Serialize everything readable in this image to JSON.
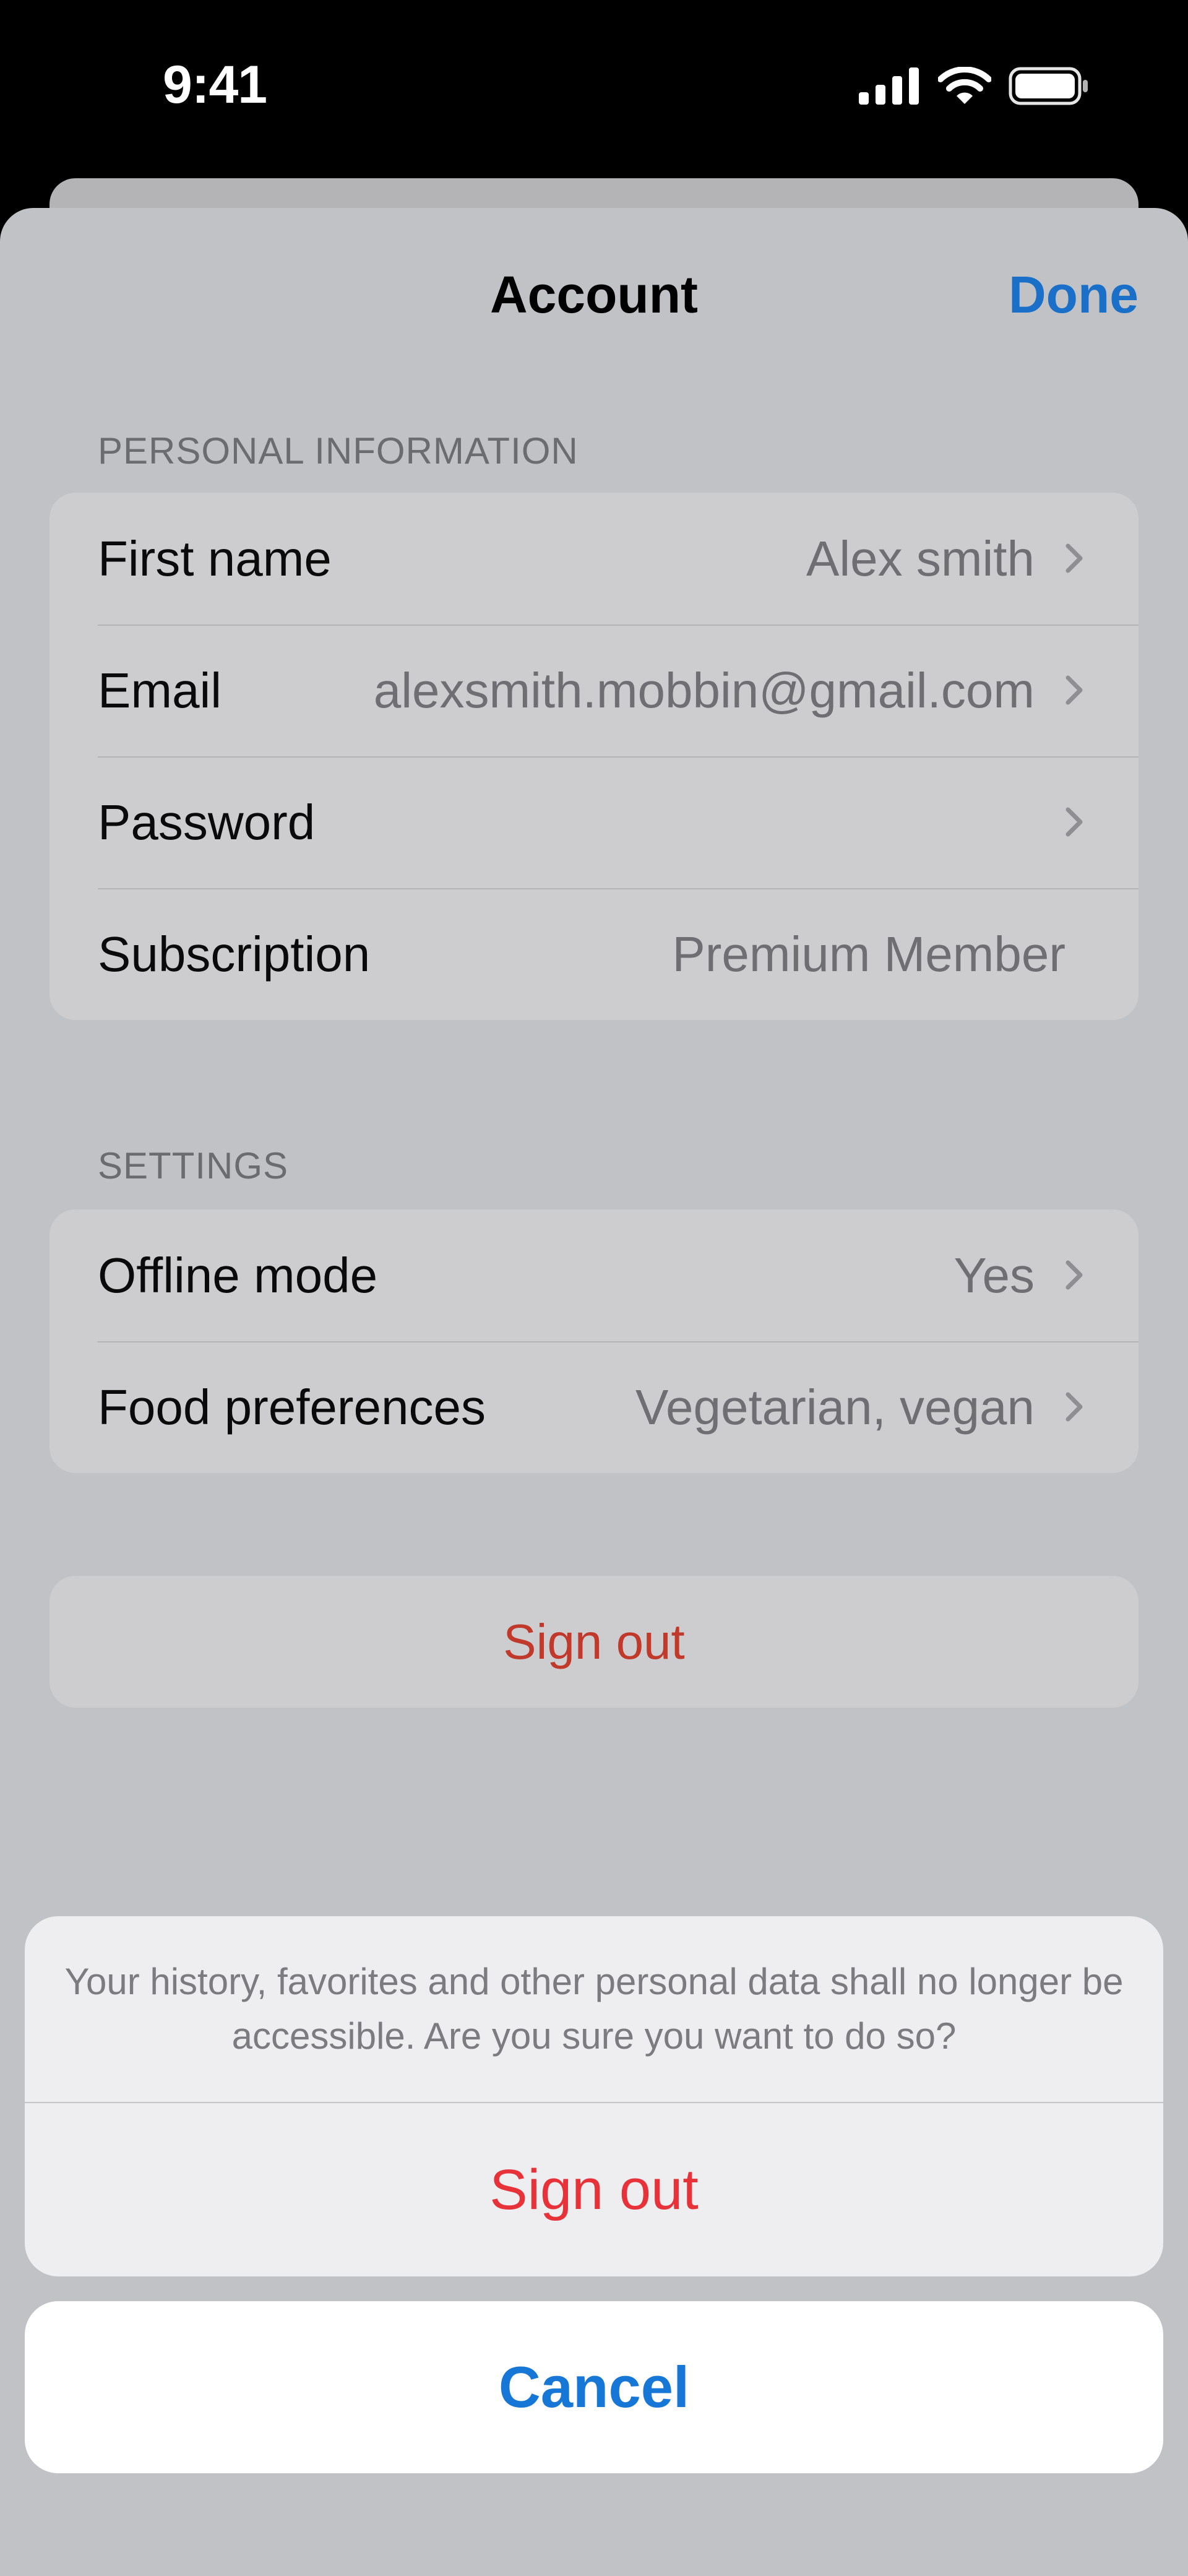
{
  "status_bar": {
    "time": "9:41",
    "icons": [
      "cellular-signal-icon",
      "wifi-icon",
      "battery-icon"
    ]
  },
  "nav": {
    "title": "Account",
    "done_label": "Done"
  },
  "personal_information": {
    "header": "PERSONAL INFORMATION",
    "rows": [
      {
        "label": "First name",
        "value": "Alex smith",
        "chevron": true
      },
      {
        "label": "Email",
        "value": "alexsmith.mobbin@gmail.com",
        "chevron": true
      },
      {
        "label": "Password",
        "value": "",
        "chevron": true
      },
      {
        "label": "Subscription",
        "value": "Premium Member",
        "chevron": false
      }
    ]
  },
  "settings": {
    "header": "SETTINGS",
    "rows": [
      {
        "label": "Offline mode",
        "value": "Yes",
        "chevron": true
      },
      {
        "label": "Food preferences",
        "value": "Vegetarian, vegan",
        "chevron": true
      }
    ]
  },
  "sign_out_row": {
    "label": "Sign out"
  },
  "action_sheet": {
    "message": "Your history, favorites and other personal data shall no longer be accessible. Are you sure you want to do so?",
    "destructive_label": "Sign out",
    "cancel_label": "Cancel"
  },
  "colors": {
    "accent": "#1a6fc8",
    "destructive": "#e8323a",
    "sheet_background": "#c1c2c6"
  }
}
